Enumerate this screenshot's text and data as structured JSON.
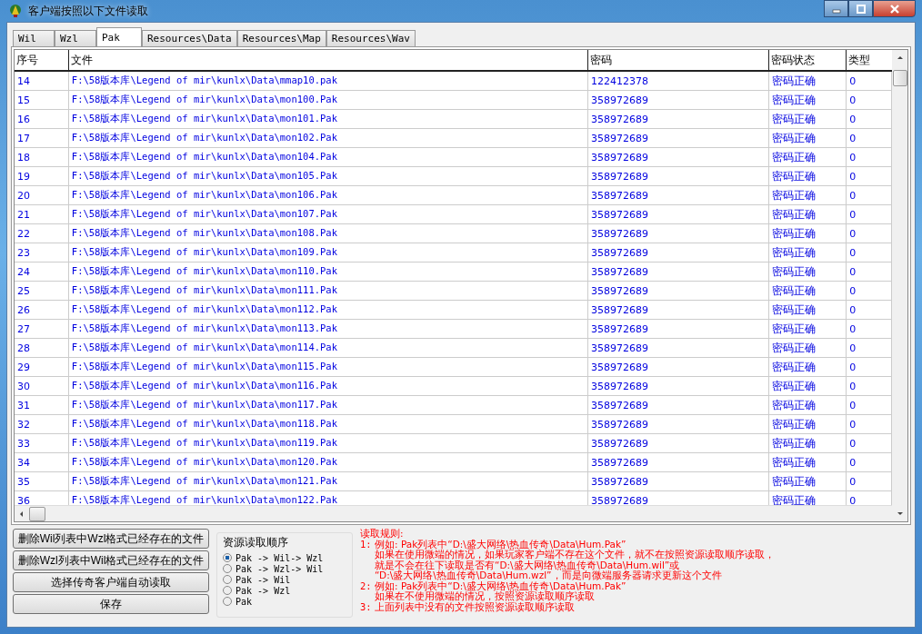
{
  "window": {
    "title": "客户端按照以下文件读取"
  },
  "tabs": [
    {
      "label": "Wil",
      "selected": false
    },
    {
      "label": "Wzl",
      "selected": false
    },
    {
      "label": "Pak",
      "selected": true
    },
    {
      "label": "Resources\\Data",
      "selected": false
    },
    {
      "label": "Resources\\Map",
      "selected": false
    },
    {
      "label": "Resources\\Wav",
      "selected": false
    }
  ],
  "table": {
    "columns": [
      "序号",
      "文件",
      "密码",
      "密码状态",
      "类型"
    ],
    "rows": [
      [
        "14",
        "F:\\58版本库\\Legend of mir\\kunlx\\Data\\mmap10.pak",
        "122412378",
        "密码正确",
        "0"
      ],
      [
        "15",
        "F:\\58版本库\\Legend of mir\\kunlx\\Data\\mon100.Pak",
        "358972689",
        "密码正确",
        "0"
      ],
      [
        "16",
        "F:\\58版本库\\Legend of mir\\kunlx\\Data\\mon101.Pak",
        "358972689",
        "密码正确",
        "0"
      ],
      [
        "17",
        "F:\\58版本库\\Legend of mir\\kunlx\\Data\\mon102.Pak",
        "358972689",
        "密码正确",
        "0"
      ],
      [
        "18",
        "F:\\58版本库\\Legend of mir\\kunlx\\Data\\mon104.Pak",
        "358972689",
        "密码正确",
        "0"
      ],
      [
        "19",
        "F:\\58版本库\\Legend of mir\\kunlx\\Data\\mon105.Pak",
        "358972689",
        "密码正确",
        "0"
      ],
      [
        "20",
        "F:\\58版本库\\Legend of mir\\kunlx\\Data\\mon106.Pak",
        "358972689",
        "密码正确",
        "0"
      ],
      [
        "21",
        "F:\\58版本库\\Legend of mir\\kunlx\\Data\\mon107.Pak",
        "358972689",
        "密码正确",
        "0"
      ],
      [
        "22",
        "F:\\58版本库\\Legend of mir\\kunlx\\Data\\mon108.Pak",
        "358972689",
        "密码正确",
        "0"
      ],
      [
        "23",
        "F:\\58版本库\\Legend of mir\\kunlx\\Data\\mon109.Pak",
        "358972689",
        "密码正确",
        "0"
      ],
      [
        "24",
        "F:\\58版本库\\Legend of mir\\kunlx\\Data\\mon110.Pak",
        "358972689",
        "密码正确",
        "0"
      ],
      [
        "25",
        "F:\\58版本库\\Legend of mir\\kunlx\\Data\\mon111.Pak",
        "358972689",
        "密码正确",
        "0"
      ],
      [
        "26",
        "F:\\58版本库\\Legend of mir\\kunlx\\Data\\mon112.Pak",
        "358972689",
        "密码正确",
        "0"
      ],
      [
        "27",
        "F:\\58版本库\\Legend of mir\\kunlx\\Data\\mon113.Pak",
        "358972689",
        "密码正确",
        "0"
      ],
      [
        "28",
        "F:\\58版本库\\Legend of mir\\kunlx\\Data\\mon114.Pak",
        "358972689",
        "密码正确",
        "0"
      ],
      [
        "29",
        "F:\\58版本库\\Legend of mir\\kunlx\\Data\\mon115.Pak",
        "358972689",
        "密码正确",
        "0"
      ],
      [
        "30",
        "F:\\58版本库\\Legend of mir\\kunlx\\Data\\mon116.Pak",
        "358972689",
        "密码正确",
        "0"
      ],
      [
        "31",
        "F:\\58版本库\\Legend of mir\\kunlx\\Data\\mon117.Pak",
        "358972689",
        "密码正确",
        "0"
      ],
      [
        "32",
        "F:\\58版本库\\Legend of mir\\kunlx\\Data\\mon118.Pak",
        "358972689",
        "密码正确",
        "0"
      ],
      [
        "33",
        "F:\\58版本库\\Legend of mir\\kunlx\\Data\\mon119.Pak",
        "358972689",
        "密码正确",
        "0"
      ],
      [
        "34",
        "F:\\58版本库\\Legend of mir\\kunlx\\Data\\mon120.Pak",
        "358972689",
        "密码正确",
        "0"
      ],
      [
        "35",
        "F:\\58版本库\\Legend of mir\\kunlx\\Data\\mon121.Pak",
        "358972689",
        "密码正确",
        "0"
      ],
      [
        "36",
        "F:\\58版本库\\Legend of mir\\kunlx\\Data\\mon122.Pak",
        "358972689",
        "密码正确",
        "0"
      ]
    ]
  },
  "buttons": [
    "删除Wil列表中Wzl格式已经存在的文件",
    "删除Wzl列表中Wil格式已经存在的文件",
    "选择传奇客户端自动读取",
    "保存"
  ],
  "read_order": {
    "title": "资源读取顺序",
    "options": [
      {
        "label": "Pak -> Wil-> Wzl",
        "selected": true
      },
      {
        "label": "Pak -> Wzl-> Wil",
        "selected": false
      },
      {
        "label": "Pak -> Wil",
        "selected": false
      },
      {
        "label": "Pak -> Wzl",
        "selected": false
      },
      {
        "label": "Pak",
        "selected": false
      }
    ]
  },
  "rules": {
    "title": "读取规则:",
    "items": [
      {
        "number": "1:",
        "lines": [
          "例如: Pak列表中“D:\\盛大网络\\热血传奇\\Data\\Hum.Pak”",
          "如果在使用微端的情况，如果玩家客户端不存在这个文件，就不在按照资源读取顺序读取，",
          "就是不会在往下读取是否有“D:\\盛大网络\\热血传奇\\Data\\Hum.wil”或",
          "“D:\\盛大网络\\热血传奇\\Data\\Hum.wzl”，而是向微端服务器请求更新这个文件"
        ]
      },
      {
        "number": "2:",
        "lines": [
          "例如: Pak列表中“D:\\盛大网络\\热血传奇\\Data\\Hum.Pak”",
          "如果在不使用微端的情况，按照资源读取顺序读取"
        ]
      },
      {
        "number": "3:",
        "lines": [
          "上面列表中没有的文件按照资源读取顺序读取"
        ]
      }
    ]
  }
}
